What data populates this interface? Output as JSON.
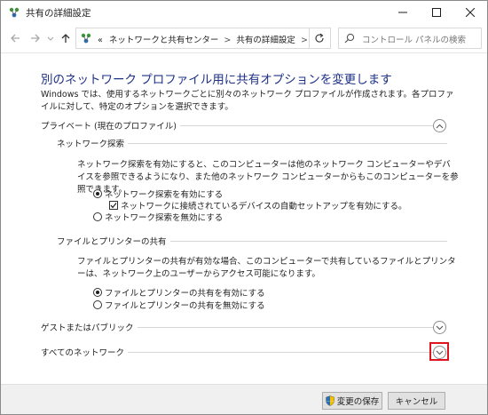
{
  "window": {
    "title": "共有の詳細設定"
  },
  "address": {
    "overflow": "«",
    "crumbs": [
      "ネットワークと共有センター",
      "共有の詳細設定"
    ],
    "separator": ">"
  },
  "search": {
    "placeholder": "コントロール パネルの検索"
  },
  "main": {
    "heading": "別のネットワーク プロファイル用に共有オプションを変更します",
    "description": "Windows では、使用するネットワークごとに別々のネットワーク プロファイルが作成されます。各プロファイルに対して、特定のオプションを選択できます。",
    "private": {
      "title": "プライベート (現在のプロファイル)",
      "discovery": {
        "title": "ネットワーク探索",
        "text": "ネットワーク探索を有効にすると、このコンピューターは他のネットワーク コンピューターやデバイスを参照できるようになり、また他のネットワーク コンピューターからもこのコンピューターを参照できます。",
        "on_label": "ネットワーク探索を有効にする",
        "auto_setup_label": "ネットワークに接続されているデバイスの自動セットアップを有効にする。",
        "off_label": "ネットワーク探索を無効にする",
        "on_selected": true,
        "auto_setup_checked": true
      },
      "sharing": {
        "title": "ファイルとプリンターの共有",
        "text": "ファイルとプリンターの共有が有効な場合、このコンピューターで共有しているファイルとプリンターは、ネットワーク上のユーザーからアクセス可能になります。",
        "on_label": "ファイルとプリンターの共有を有効にする",
        "off_label": "ファイルとプリンターの共有を無効にする",
        "on_selected": true
      }
    },
    "guest": {
      "title": "ゲストまたはパブリック"
    },
    "all": {
      "title": "すべてのネットワーク"
    }
  },
  "footer": {
    "save_label": "変更の保存",
    "cancel_label": "キャンセル"
  },
  "colors": {
    "heading": "#1e3287",
    "highlight": "#e0141e",
    "footer_bg": "#f0f0f0"
  },
  "icons": [
    "network-icon",
    "minimize-icon",
    "maximize-icon",
    "close-icon",
    "back-arrow-icon",
    "forward-arrow-icon",
    "dropdown-icon",
    "up-arrow-icon",
    "refresh-icon",
    "search-icon",
    "chevron-up-icon",
    "chevron-down-icon",
    "shield-icon"
  ]
}
